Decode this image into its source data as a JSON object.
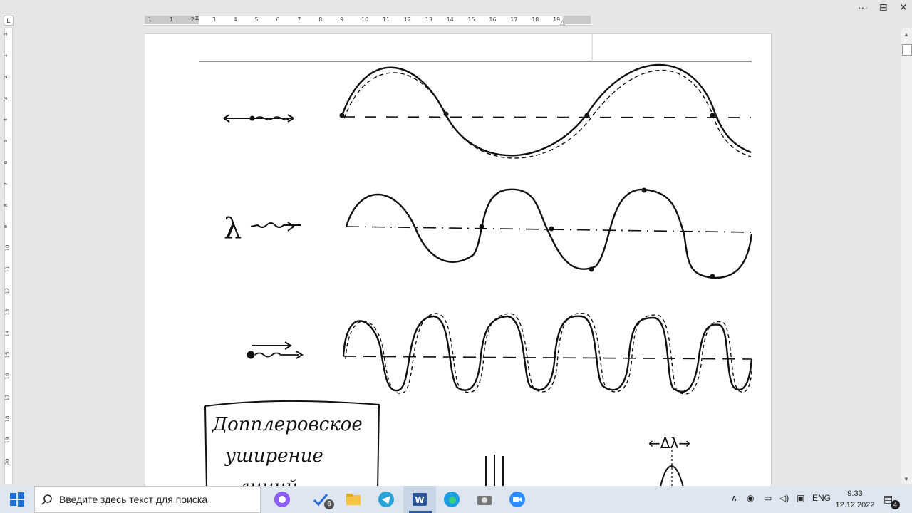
{
  "window": {
    "more_label": "···",
    "restore_label": "⊟",
    "close_label": "✕"
  },
  "ruler": {
    "corner_label": "L",
    "h_numbers": [
      "1",
      "1",
      "2",
      "3",
      "4",
      "5",
      "6",
      "7",
      "8",
      "9",
      "10",
      "11",
      "12",
      "13",
      "14",
      "15",
      "16",
      "17",
      "18",
      "19"
    ],
    "v_numbers": [
      "1",
      "1",
      "2",
      "3",
      "4",
      "5",
      "6",
      "7",
      "8",
      "9",
      "10",
      "11",
      "12",
      "13",
      "14",
      "15",
      "16",
      "17",
      "18",
      "19",
      "20"
    ]
  },
  "document": {
    "box_text": [
      "Допплеровское",
      "уширение",
      "линий"
    ],
    "delta_lambda_label": "←Δλ→",
    "lambda_label": "λ"
  },
  "taskbar": {
    "search_placeholder": "Введите здесь текст для поиска",
    "badge_count": "6",
    "language": "ENG",
    "time": "9:33",
    "date": "12.12.2022",
    "notification_count": "4"
  },
  "colors": {
    "taskbar_bg": "#dde6f1",
    "word_blue": "#2b579a",
    "telegram": "#2aa3d8",
    "zoom": "#2d8cff"
  }
}
